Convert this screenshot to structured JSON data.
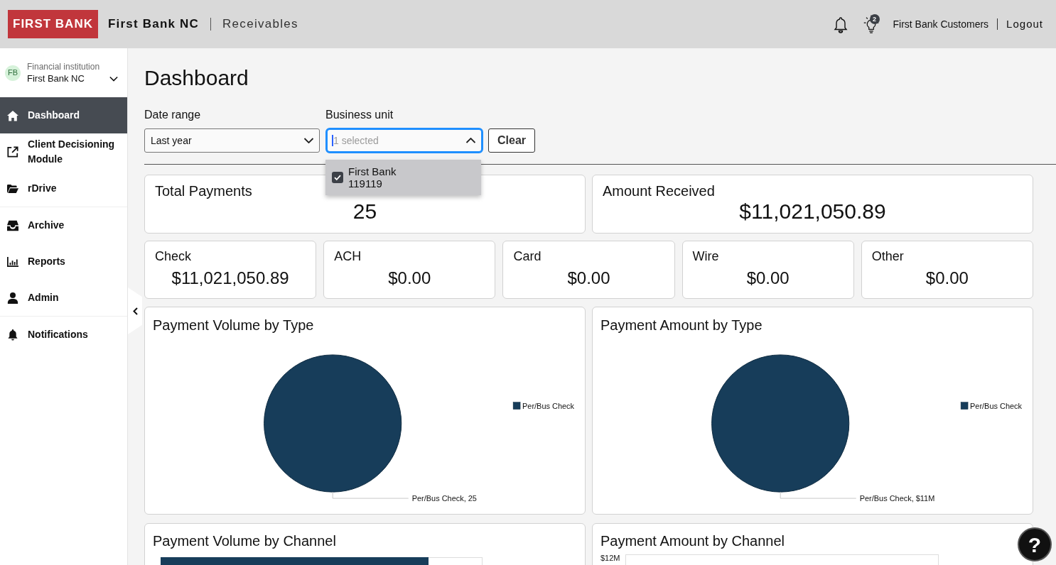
{
  "header": {
    "logo": "FIRST BANK",
    "institution": "First Bank NC",
    "product": "Receivables",
    "tips_badge": "2",
    "user": "First Bank Customers",
    "logout": "Logout"
  },
  "sidebar": {
    "institution_label": "Financial institution",
    "institution": "First Bank NC",
    "avatar": "FB",
    "groups": [
      {
        "items": [
          {
            "label": "Dashboard",
            "selected": true
          },
          {
            "label": "Client Decisioning Module",
            "selected": false
          },
          {
            "label": "rDrive",
            "selected": false
          }
        ]
      },
      {
        "items": [
          {
            "label": "Archive",
            "selected": false
          },
          {
            "label": "Reports",
            "selected": false
          },
          {
            "label": "Admin",
            "selected": false
          }
        ]
      },
      {
        "items": [
          {
            "label": "Notifications",
            "selected": false
          }
        ]
      }
    ]
  },
  "page": {
    "title": "Dashboard"
  },
  "filters": {
    "date_range": {
      "label": "Date range",
      "value": "Last year"
    },
    "business_unit": {
      "label": "Business unit",
      "placeholder": "1 selected",
      "focused": true,
      "expanded": true,
      "options": [
        {
          "label": "First Bank",
          "code": "119119",
          "checked": true
        }
      ]
    },
    "clear_button": "Clear"
  },
  "totals": [
    {
      "title": "Total Payments",
      "value": "25"
    },
    {
      "title": "Amount Received",
      "value": "$11,021,050.89"
    }
  ],
  "payment_types": [
    {
      "title": "Check",
      "value": "$11,021,050.89"
    },
    {
      "title": "ACH",
      "value": "$0.00"
    },
    {
      "title": "Card",
      "value": "$0.00"
    },
    {
      "title": "Wire",
      "value": "$0.00"
    },
    {
      "title": "Other",
      "value": "$0.00"
    }
  ],
  "type_charts": [
    {
      "chart_data": {
        "type": "pie",
        "title": "Payment Volume by Type",
        "categories": [
          "Per/Bus Check"
        ],
        "series": [
          {
            "color": "#173d5a",
            "values": [
              100
            ]
          }
        ],
        "value_labels": [
          "Per/Bus Check, 25"
        ]
      }
    },
    {
      "chart_data": {
        "type": "pie",
        "title": "Payment Amount by Type",
        "categories": [
          "Per/Bus Check"
        ],
        "series": [
          {
            "color": "#173d5a",
            "values": [
              100
            ]
          }
        ],
        "value_labels": [
          "Per/Bus Check, $11M"
        ]
      }
    }
  ],
  "channel_charts": [
    {
      "title": "Payment Volume by Channel",
      "kind": "bar"
    },
    {
      "title": "Payment Amount by Channel",
      "kind": "axis",
      "axis_label": "$12M"
    }
  ],
  "help_button": "?"
}
